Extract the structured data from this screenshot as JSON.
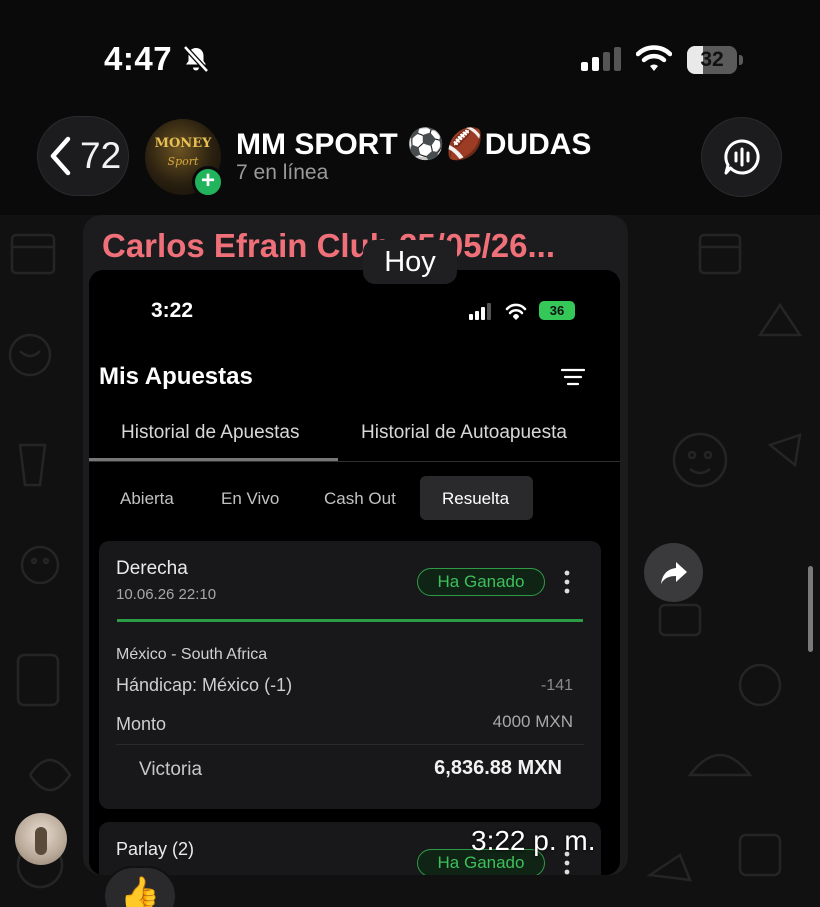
{
  "status_bar": {
    "time": "4:47",
    "battery": "32",
    "battery_level": 0.32,
    "icons": [
      "bell-slash-icon",
      "cellular-signal-icon",
      "wifi-icon",
      "battery-icon"
    ]
  },
  "header": {
    "back_count": "72",
    "group_name": "MM SPORT",
    "group_emojis": [
      "⚽",
      "🏈"
    ],
    "group_suffix": "DUDAS",
    "subtitle": "7 en línea",
    "avatar_logo_main": "MONEY",
    "avatar_logo_sub": "Sport"
  },
  "chat": {
    "date_chip": "Hoy",
    "message": {
      "sender": "Carlos Efrain Club 25/05/26...",
      "time": "3:22 p. m.",
      "reaction": "👍",
      "screenshot": {
        "time": "3:22",
        "battery": "36",
        "title": "Mis Apuestas",
        "tabs": [
          "Historial de Apuestas",
          "Historial de Autoapuesta"
        ],
        "subtabs": [
          "Abierta",
          "En Vivo",
          "Cash Out",
          "Resuelta"
        ],
        "active_subtab": "Resuelta",
        "bets": [
          {
            "type": "Derecha",
            "datetime": "10.06.26 22:10",
            "status": "Ha Ganado",
            "match": "México - South Africa",
            "pick": "Hándicap: México (-1)",
            "odds": "-141",
            "amount_label": "Monto",
            "amount": "4000 MXN",
            "win_label": "Victoria",
            "win": "6,836.88 MXN"
          },
          {
            "type": "Parlay (2)",
            "status": "Ha Ganado"
          }
        ]
      }
    }
  },
  "colors": {
    "sender_name": "#f0707a",
    "won_green": "#3fbf5b",
    "online_badge": "#22b45c"
  }
}
